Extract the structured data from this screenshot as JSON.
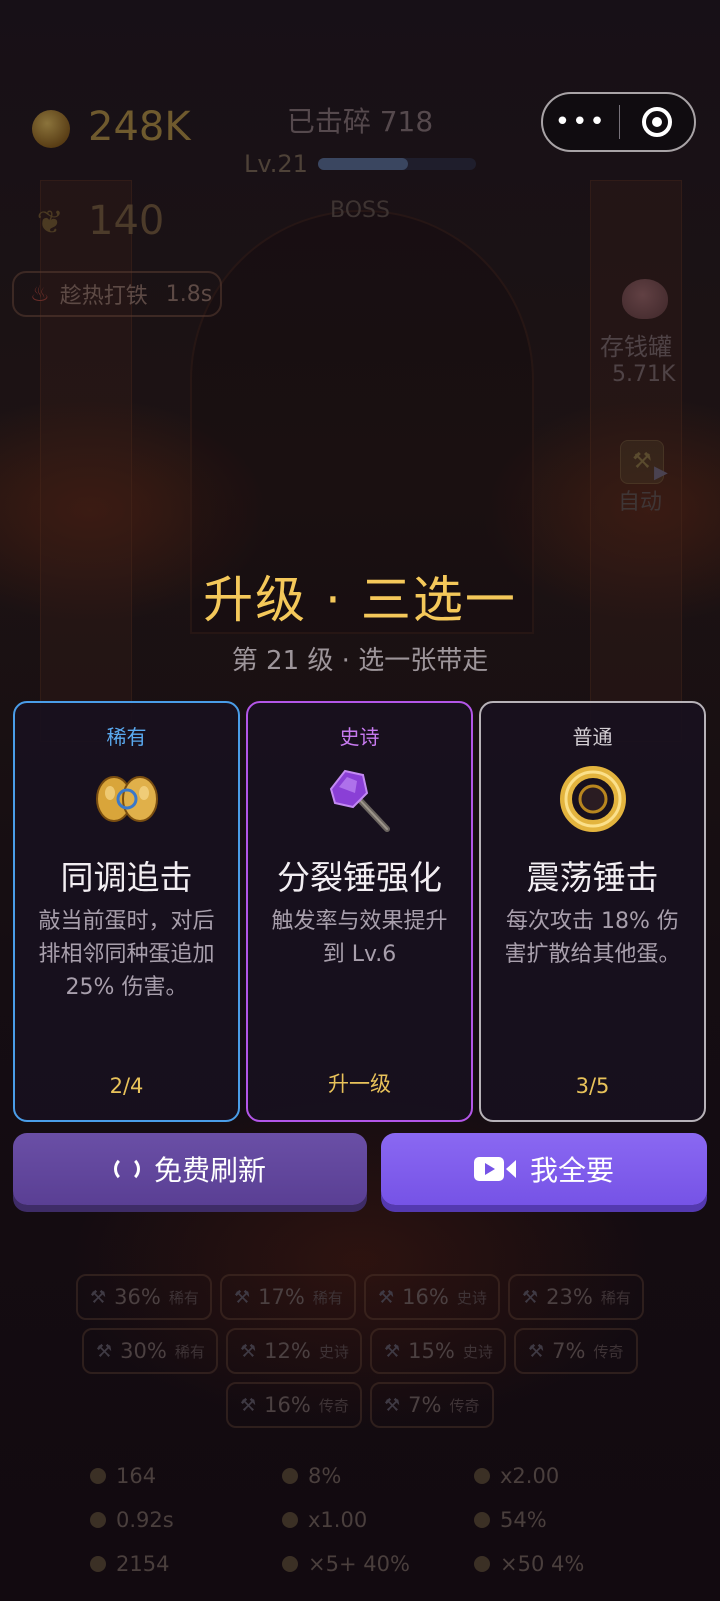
{
  "hud": {
    "coins": "248K",
    "leaves": "140",
    "heat_label": "趁热打铁",
    "heat_time": "1.8s",
    "smashed": "已击碎 718",
    "level": "Lv.21",
    "level_progress": 0.57,
    "boss": "BOSS",
    "bank_label": "存钱罐",
    "bank_value": "5.71K",
    "auto_label": "自动",
    "menu_more": "•••"
  },
  "modal": {
    "title": "升级 · 三选一",
    "subtitle": "第 21 级 · 选一张带走",
    "cards": [
      {
        "rarity": "稀有",
        "name": "同调追击",
        "desc": "敲当前蛋时，对后排相邻同种蛋追加 25% 伤害。",
        "progress": "2/4",
        "icon": "twin-egg-icon"
      },
      {
        "rarity": "史诗",
        "name": "分裂锤强化",
        "desc": "触发率与效果提升到 Lv.6",
        "progress": "升一级",
        "icon": "crystal-hammer-icon"
      },
      {
        "rarity": "普通",
        "name": "震荡锤击",
        "desc": "每次攻击 18% 伤害扩散给其他蛋。",
        "progress": "3/5",
        "icon": "golden-ring-icon"
      }
    ],
    "refresh_label": "免费刷新",
    "take_all_label": "我全要"
  },
  "colors": {
    "rare": "#4a9de8",
    "epic": "#b356e8",
    "common": "#b7b2b8",
    "title": "#f4c85a",
    "primary_button": "#7653e6"
  },
  "chips": [
    {
      "pct": "36%",
      "tier": "稀有"
    },
    {
      "pct": "17%",
      "tier": "稀有"
    },
    {
      "pct": "16%",
      "tier": "史诗"
    },
    {
      "pct": "23%",
      "tier": "稀有"
    },
    {
      "pct": "30%",
      "tier": "稀有"
    },
    {
      "pct": "12%",
      "tier": "史诗"
    },
    {
      "pct": "15%",
      "tier": "史诗"
    },
    {
      "pct": "7%",
      "tier": "传奇"
    },
    {
      "pct": "16%",
      "tier": "传奇"
    },
    {
      "pct": "7%",
      "tier": "传奇"
    }
  ],
  "stats": [
    "164",
    "8%",
    "x2.00",
    "0.92s",
    "x1.00",
    "54%",
    "2154",
    "×5+ 40%",
    "×50 4%"
  ]
}
